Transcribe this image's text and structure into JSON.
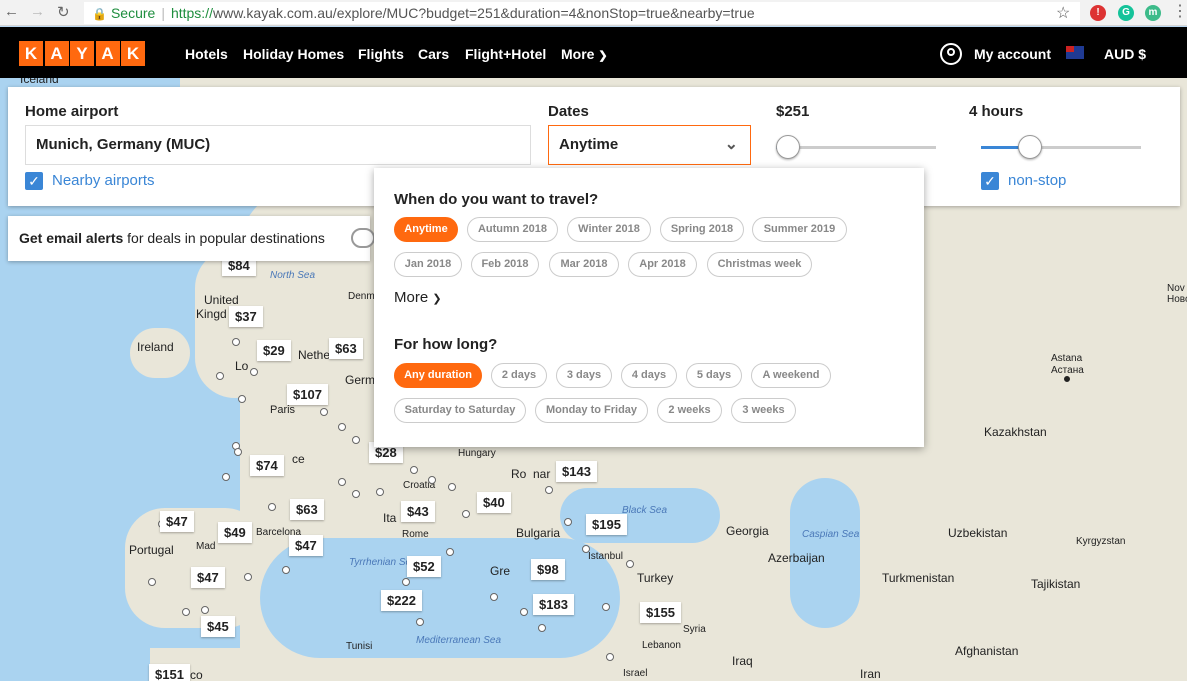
{
  "browser": {
    "secure_label": "Secure",
    "url_https": "https://",
    "url_rest": "www.kayak.com.au/explore/MUC?budget=251&duration=4&nonStop=true&nearby=true"
  },
  "nav": {
    "logo_letters": [
      "K",
      "A",
      "Y",
      "A",
      "K"
    ],
    "links": [
      "Hotels",
      "Holiday Homes",
      "Flights",
      "Cars",
      "Flight+Hotel",
      "More"
    ],
    "account": "My account",
    "currency": "AUD $"
  },
  "search": {
    "home_label": "Home airport",
    "home_value": "Munich, Germany (MUC)",
    "nearby_label": "Nearby airports",
    "dates_label": "Dates",
    "dates_value": "Anytime",
    "budget_label": "$251",
    "budget_level": 0.0,
    "duration_label": "4 hours",
    "duration_level": 0.27,
    "nonstop_label": "non-stop"
  },
  "alerts": {
    "bold": "Get email alerts",
    "rest": " for deals in popular destinations"
  },
  "dropdown": {
    "when_title": "When do you want to travel?",
    "when_options": [
      "Anytime",
      "Autumn 2018",
      "Winter 2018",
      "Spring 2018",
      "Summer 2019",
      "Jan 2018",
      "Feb 2018",
      "Mar 2018",
      "Apr 2018",
      "Christmas week"
    ],
    "when_selected": "Anytime",
    "more_label": "More",
    "howlong_title": "For how long?",
    "howlong_options": [
      "Any duration",
      "2 days",
      "3 days",
      "4 days",
      "5 days",
      "A weekend",
      "Saturday to Saturday",
      "Monday to Friday",
      "2 weeks",
      "3 weeks"
    ],
    "howlong_selected": "Any duration"
  },
  "map": {
    "labels": [
      "Iceland",
      "North Sea",
      "United",
      "Kingd",
      "Ireland",
      "Lo",
      "Nethe",
      "Denm",
      "Germ",
      "Paris",
      "Hungary",
      "Ro",
      "nar",
      "Croatia",
      "Ita",
      "Rome",
      "Bulgaria",
      "Istanbul",
      "Black Sea",
      "Georgia",
      "Caspian Sea",
      "Azerbaijan",
      "Uzbekistan",
      "Kyrgyzstan",
      "Turkmenistan",
      "Tajikistan",
      "Kazakhstan",
      "Astana",
      "Астана",
      "Turkey",
      "Syria",
      "Lebanon",
      "Israel",
      "Iraq",
      "Iran",
      "Afghanistan",
      "Portugal",
      "Mad",
      "Barcelona",
      "Tyrrhenian Sea",
      "Mediterranean Sea",
      "Tunisi",
      "Gre",
      "Nov",
      "Ново",
      "ce",
      "co"
    ],
    "prices": [
      "$84",
      "$37",
      "$29",
      "$63",
      "$107",
      "$28",
      "$74",
      "$143",
      "$40",
      "$43",
      "$63",
      "$47",
      "$49",
      "$47",
      "$195",
      "$52",
      "$98",
      "$47",
      "$222",
      "$183",
      "$45",
      "$155",
      "$151"
    ]
  }
}
